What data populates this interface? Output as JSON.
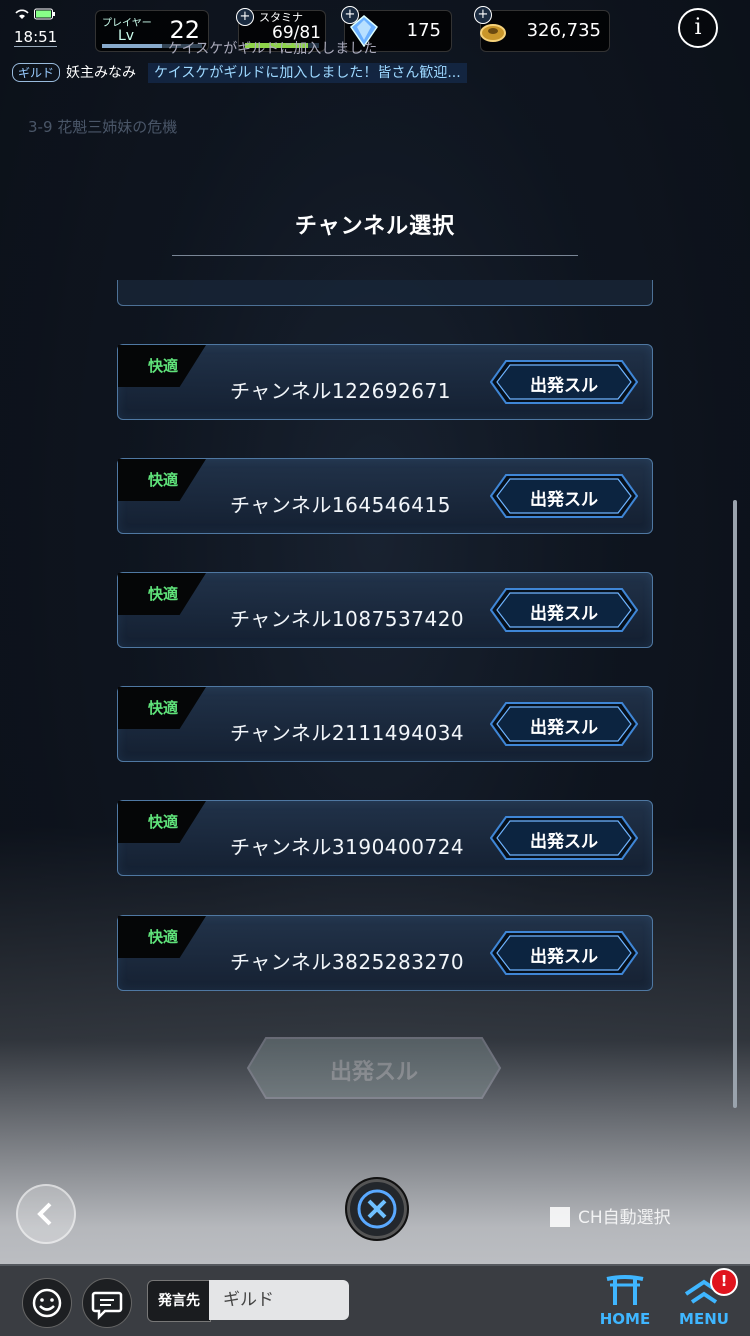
{
  "status": {
    "time": "18:51"
  },
  "header": {
    "player_label": "プレイヤー",
    "lv_label": "Lv",
    "level": "22",
    "level_progress": 0.6,
    "stamina_label": "スタミナ",
    "stamina": "69/81",
    "stamina_progress": 0.85,
    "gems": "175",
    "gold": "326,735",
    "info_icon": "i"
  },
  "guild": {
    "tag": "ギルド",
    "name": "妖主みなみ",
    "message": "ケイスケがギルドに加入しました！皆さん歓迎...",
    "ticker": "ケイスケがギルドに加入しました"
  },
  "background": {
    "stage": "3-9 花魁三姉妹の危機"
  },
  "modal": {
    "title": "チャンネル選択",
    "channels": [
      {
        "status": "快適",
        "name": "チャンネル122692671",
        "button": "出発スル"
      },
      {
        "status": "快適",
        "name": "チャンネル164546415",
        "button": "出発スル"
      },
      {
        "status": "快適",
        "name": "チャンネル1087537420",
        "button": "出発スル"
      },
      {
        "status": "快適",
        "name": "チャンネル2111494034",
        "button": "出発スル"
      },
      {
        "status": "快適",
        "name": "チャンネル3190400724",
        "button": "出発スル"
      },
      {
        "status": "快適",
        "name": "チャンネル3825283270",
        "button": "出発スル"
      }
    ],
    "ghost_button": "出発スル",
    "auto_select": "CH自動選択"
  },
  "chat": {
    "target_label": "発言先",
    "target_value": "ギルド"
  },
  "nav": {
    "home": "HOME",
    "menu": "MENU",
    "menu_badge": "!"
  },
  "colors": {
    "accent_blue": "#3fb6ff",
    "status_green": "#5fe27a",
    "card_border": "#4f78a2",
    "notification": "#e0141e"
  },
  "icons": [
    "wifi-icon",
    "battery-icon",
    "plus-icon",
    "gem-icon",
    "coin-icon",
    "info-icon",
    "close-icon",
    "back-arrow-icon",
    "emoji-icon",
    "chat-bubble-icon",
    "torii-gate-icon",
    "menu-roof-icon"
  ]
}
